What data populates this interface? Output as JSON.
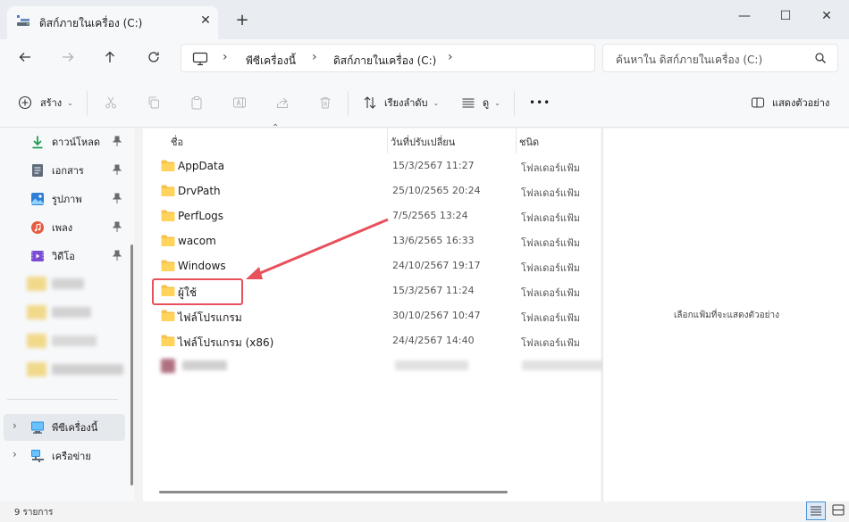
{
  "window": {
    "tab_title": "ดิสก์ภายในเครื่อง (C:)",
    "new_tab_label": "+",
    "minimize_label": "—",
    "maximize_label": "☐",
    "close_label": "✕"
  },
  "address": {
    "crumbs": [
      "พีซีเครื่องนี้",
      "ดิสก์ภายในเครื่อง (C:)"
    ]
  },
  "search": {
    "placeholder": "ค้นหาใน ดิสก์ภายในเครื่อง (C:)"
  },
  "toolbar": {
    "new_label": "สร้าง",
    "sort_label": "เรียงลำดับ",
    "view_label": "ดู",
    "more_label": "•••",
    "details_label": "แสดงตัวอย่าง"
  },
  "sidebar": {
    "items": [
      {
        "label": "ดาวน์โหลด",
        "icon": "download-icon"
      },
      {
        "label": "เอกสาร",
        "icon": "document-icon"
      },
      {
        "label": "รูปภาพ",
        "icon": "pictures-icon"
      },
      {
        "label": "เพลง",
        "icon": "music-icon"
      },
      {
        "label": "วิดีโอ",
        "icon": "video-icon"
      }
    ],
    "this_pc": "พีซีเครื่องนี้",
    "network": "เครือข่าย"
  },
  "columns": {
    "name": "ชื่อ",
    "date": "วันที่ปรับเปลี่ยน",
    "type": "ชนิด"
  },
  "files": [
    {
      "name": "AppData",
      "date": "15/3/2567 11:27",
      "type": "โฟลเดอร์แฟ้ม"
    },
    {
      "name": "DrvPath",
      "date": "25/10/2565 20:24",
      "type": "โฟลเดอร์แฟ้ม"
    },
    {
      "name": "PerfLogs",
      "date": "7/5/2565 13:24",
      "type": "โฟลเดอร์แฟ้ม"
    },
    {
      "name": "wacom",
      "date": "13/6/2565 16:33",
      "type": "โฟลเดอร์แฟ้ม"
    },
    {
      "name": "Windows",
      "date": "24/10/2567 19:17",
      "type": "โฟลเดอร์แฟ้ม"
    },
    {
      "name": "ผู้ใช้",
      "date": "15/3/2567 11:24",
      "type": "โฟลเดอร์แฟ้ม"
    },
    {
      "name": "ไฟล์โปรแกรม",
      "date": "30/10/2567 10:47",
      "type": "โฟลเดอร์แฟ้ม"
    },
    {
      "name": "ไฟล์โปรแกรม (x86)",
      "date": "24/4/2567 14:40",
      "type": "โฟลเดอร์แฟ้ม"
    }
  ],
  "preview": {
    "message": "เลือกแฟ้มที่จะแสดงตัวอย่าง"
  },
  "status": {
    "count": "9 รายการ"
  },
  "colors": {
    "folder": "#f4c24d",
    "highlight": "#e8505b",
    "selected_nav": "#e5e8ec"
  }
}
